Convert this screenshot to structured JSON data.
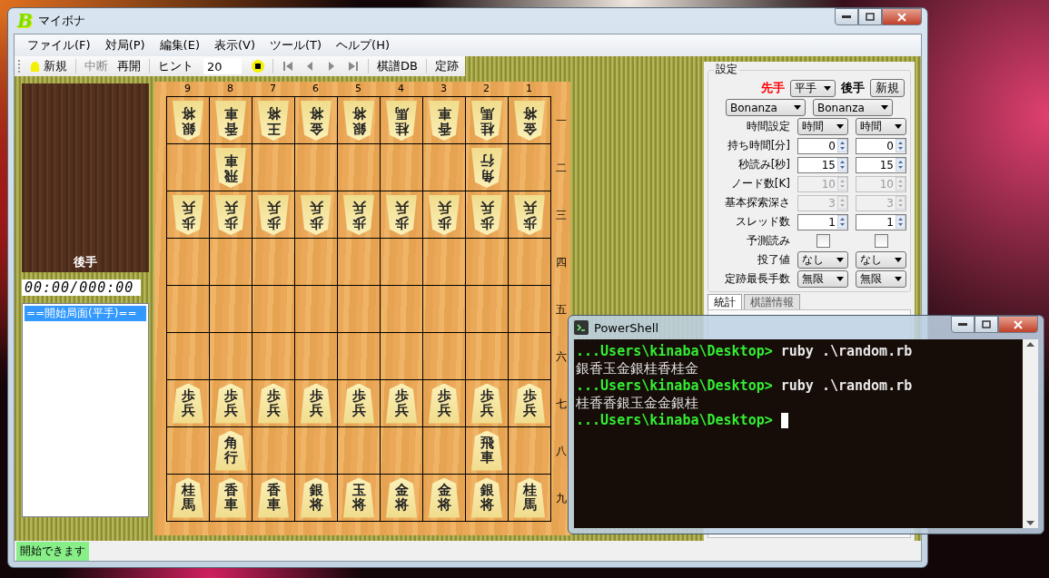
{
  "window": {
    "logo": "B",
    "title": "マイボナ"
  },
  "menu": [
    "ファイル(F)",
    "対局(P)",
    "編集(E)",
    "表示(V)",
    "ツール(T)",
    "ヘルプ(H)"
  ],
  "toolbar": [
    {
      "kind": "new",
      "label": "新規",
      "disabled": false
    },
    {
      "kind": "separator"
    },
    {
      "kind": "button",
      "label": "中断",
      "disabled": true
    },
    {
      "kind": "button",
      "label": "再開",
      "disabled": false
    },
    {
      "kind": "separator"
    },
    {
      "kind": "button",
      "label": "ヒント",
      "disabled": false
    },
    {
      "kind": "field",
      "value": "20"
    },
    {
      "kind": "stop"
    },
    {
      "kind": "separator"
    },
    {
      "kind": "first"
    },
    {
      "kind": "prev"
    },
    {
      "kind": "next"
    },
    {
      "kind": "last"
    },
    {
      "kind": "separator"
    },
    {
      "kind": "button",
      "label": "棋譜DB",
      "disabled": false
    },
    {
      "kind": "separator"
    },
    {
      "kind": "button",
      "label": "定跡",
      "disabled": false
    }
  ],
  "komadai": {
    "label": "後手"
  },
  "clock": "00:00/000:00",
  "kifu": [
    {
      "text": "==開始局面(平手)==",
      "selected": true
    }
  ],
  "board": {
    "files": [
      "9",
      "8",
      "7",
      "6",
      "5",
      "4",
      "3",
      "2",
      "1"
    ],
    "ranks": [
      {
        "label": "一",
        "cells": [
          {
            "piece": "銀将",
            "upside_down": true
          },
          {
            "piece": "香車",
            "upside_down": true
          },
          {
            "piece": "王将",
            "upside_down": true
          },
          {
            "piece": "金将",
            "upside_down": true
          },
          {
            "piece": "銀将",
            "upside_down": true
          },
          {
            "piece": "桂馬",
            "upside_down": true
          },
          {
            "piece": "香車",
            "upside_down": true
          },
          {
            "piece": "桂馬",
            "upside_down": true
          },
          {
            "piece": "金将",
            "upside_down": true
          }
        ]
      },
      {
        "label": "二",
        "cells": [
          {},
          {
            "piece": "飛車",
            "upside_down": true
          },
          {},
          {},
          {},
          {},
          {},
          {
            "piece": "角行",
            "upside_down": true
          },
          {}
        ]
      },
      {
        "label": "三",
        "cells": [
          {
            "piece": "歩兵",
            "upside_down": true
          },
          {
            "piece": "歩兵",
            "upside_down": true
          },
          {
            "piece": "歩兵",
            "upside_down": true
          },
          {
            "piece": "歩兵",
            "upside_down": true
          },
          {
            "piece": "歩兵",
            "upside_down": true
          },
          {
            "piece": "歩兵",
            "upside_down": true
          },
          {
            "piece": "歩兵",
            "upside_down": true
          },
          {
            "piece": "歩兵",
            "upside_down": true
          },
          {
            "piece": "歩兵",
            "upside_down": true
          }
        ]
      },
      {
        "label": "四",
        "cells": [
          {},
          {},
          {},
          {},
          {},
          {},
          {},
          {},
          {}
        ]
      },
      {
        "label": "五",
        "cells": [
          {},
          {},
          {},
          {},
          {},
          {},
          {},
          {},
          {}
        ]
      },
      {
        "label": "六",
        "cells": [
          {},
          {},
          {},
          {},
          {},
          {},
          {},
          {},
          {}
        ]
      },
      {
        "label": "七",
        "cells": [
          {
            "piece": "歩兵",
            "upside_down": false
          },
          {
            "piece": "歩兵",
            "upside_down": false
          },
          {
            "piece": "歩兵",
            "upside_down": false
          },
          {
            "piece": "歩兵",
            "upside_down": false
          },
          {
            "piece": "歩兵",
            "upside_down": false
          },
          {
            "piece": "歩兵",
            "upside_down": false
          },
          {
            "piece": "歩兵",
            "upside_down": false
          },
          {
            "piece": "歩兵",
            "upside_down": false
          },
          {
            "piece": "歩兵",
            "upside_down": false
          }
        ]
      },
      {
        "label": "八",
        "cells": [
          {},
          {
            "piece": "角行",
            "upside_down": false
          },
          {},
          {},
          {},
          {},
          {},
          {
            "piece": "飛車",
            "upside_down": false
          },
          {}
        ]
      },
      {
        "label": "九",
        "cells": [
          {
            "piece": "桂馬",
            "upside_down": false
          },
          {
            "piece": "香車",
            "upside_down": false
          },
          {
            "piece": "香車",
            "upside_down": false
          },
          {
            "piece": "銀将",
            "upside_down": false
          },
          {
            "piece": "玉将",
            "upside_down": false
          },
          {
            "piece": "金将",
            "upside_down": false
          },
          {
            "piece": "金将",
            "upside_down": false
          },
          {
            "piece": "銀将",
            "upside_down": false
          },
          {
            "piece": "桂馬",
            "upside_down": false
          }
        ]
      }
    ]
  },
  "settings": {
    "title": "設定",
    "sente_label": "先手",
    "handicap": "平手",
    "gote_label": "後手",
    "new_button": "新規",
    "engines": [
      "Bonanza",
      "Bonanza"
    ],
    "rows": [
      {
        "kind": "select",
        "label": "時間設定",
        "values": [
          "時間",
          "時間"
        ]
      },
      {
        "kind": "spin",
        "label": "持ち時間[分]",
        "values": [
          "0",
          "0"
        ],
        "disabled": false
      },
      {
        "kind": "spin",
        "label": "秒読み[秒]",
        "values": [
          "15",
          "15"
        ],
        "disabled": false
      },
      {
        "kind": "spin",
        "label": "ノード数[K]",
        "values": [
          "10",
          "10"
        ],
        "disabled": true
      },
      {
        "kind": "spin",
        "label": "基本探索深さ",
        "values": [
          "3",
          "3"
        ],
        "disabled": true
      },
      {
        "kind": "spin",
        "label": "スレッド数",
        "values": [
          "1",
          "1"
        ],
        "disabled": false
      },
      {
        "kind": "check",
        "label": "予測読み",
        "checked": [
          false,
          false
        ]
      },
      {
        "kind": "select",
        "label": "投了値",
        "values": [
          "なし",
          "なし"
        ]
      },
      {
        "kind": "select",
        "label": "定跡最長手数",
        "values": [
          "無限",
          "無限"
        ]
      }
    ]
  },
  "tabs": [
    {
      "label": "統計",
      "selected": true
    },
    {
      "label": "棋譜情報",
      "selected": false
    }
  ],
  "status_bar": "開始できます",
  "powershell": {
    "title": "PowerShell",
    "lines": [
      {
        "kind": "prompt",
        "prompt": "...Users\\kinaba\\Desktop>",
        "command": "ruby .\\random.rb"
      },
      {
        "kind": "output",
        "text": "銀香玉金銀桂香桂金"
      },
      {
        "kind": "prompt",
        "prompt": "...Users\\kinaba\\Desktop>",
        "command": "ruby .\\random.rb"
      },
      {
        "kind": "output",
        "text": "桂香香銀玉金金銀桂"
      },
      {
        "kind": "prompt",
        "prompt": "...Users\\kinaba\\Desktop>",
        "cursor": true
      }
    ]
  }
}
